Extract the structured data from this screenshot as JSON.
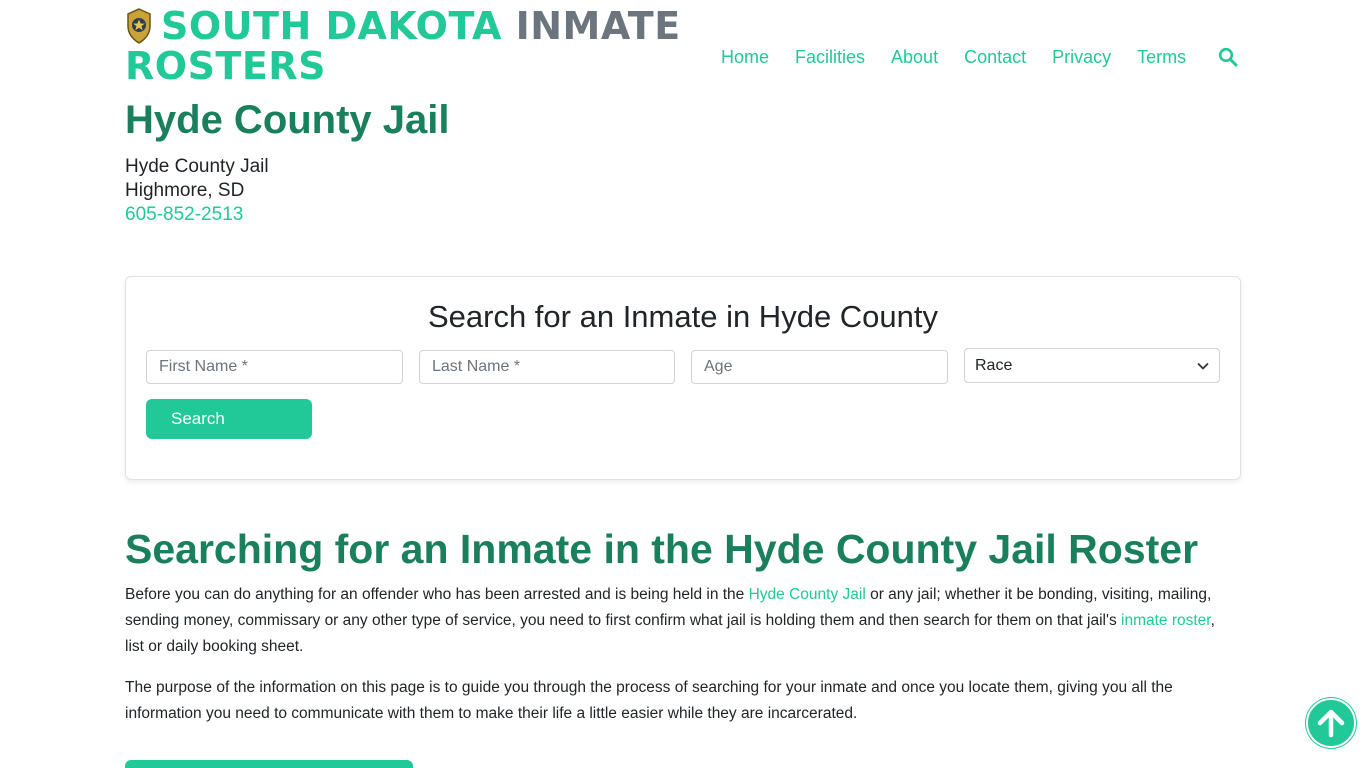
{
  "header": {
    "brand_part1": "SOUTH DAKOTA",
    "brand_part2": "INMATE",
    "brand_part3": "ROSTERS",
    "nav": [
      "Home",
      "Facilities",
      "About",
      "Contact",
      "Privacy",
      "Terms"
    ],
    "icons": {
      "logo": "sheriff-badge-icon",
      "search": "search-icon"
    }
  },
  "facility": {
    "title": "Hyde County Jail",
    "name": "Hyde County Jail",
    "location": "Highmore, SD",
    "phone": "605-852-2513"
  },
  "search_form": {
    "heading": "Search for an Inmate in Hyde County",
    "first_name_placeholder": "First Name *",
    "last_name_placeholder": "Last Name *",
    "age_placeholder": "Age",
    "race_selected": "Race",
    "submit_label": "Search"
  },
  "article": {
    "title": "Searching for an Inmate in the Hyde County Jail Roster",
    "p1_before": "Before you can do anything for an offender who has been arrested and is being held in the ",
    "p1_link1": "Hyde County Jail",
    "p1_middle": " or any jail; whether it be bonding, visiting, mailing, sending money, commissary or any other type of service, you need to first confirm what jail is holding them and then search for them on that jail's ",
    "p1_link2": "inmate roster",
    "p1_after": ", list or daily booking sheet.",
    "p2": "The purpose of the information on this page is to guide you through the process of searching for your inmate and once you locate them, giving you all the information you need to communicate with them to make their life a little easier while they are incarcerated."
  },
  "colors": {
    "accent": "#20c997",
    "heading": "#1a7f5d",
    "muted": "#6c757d"
  },
  "back_to_top_icon": "arrow-up-icon"
}
